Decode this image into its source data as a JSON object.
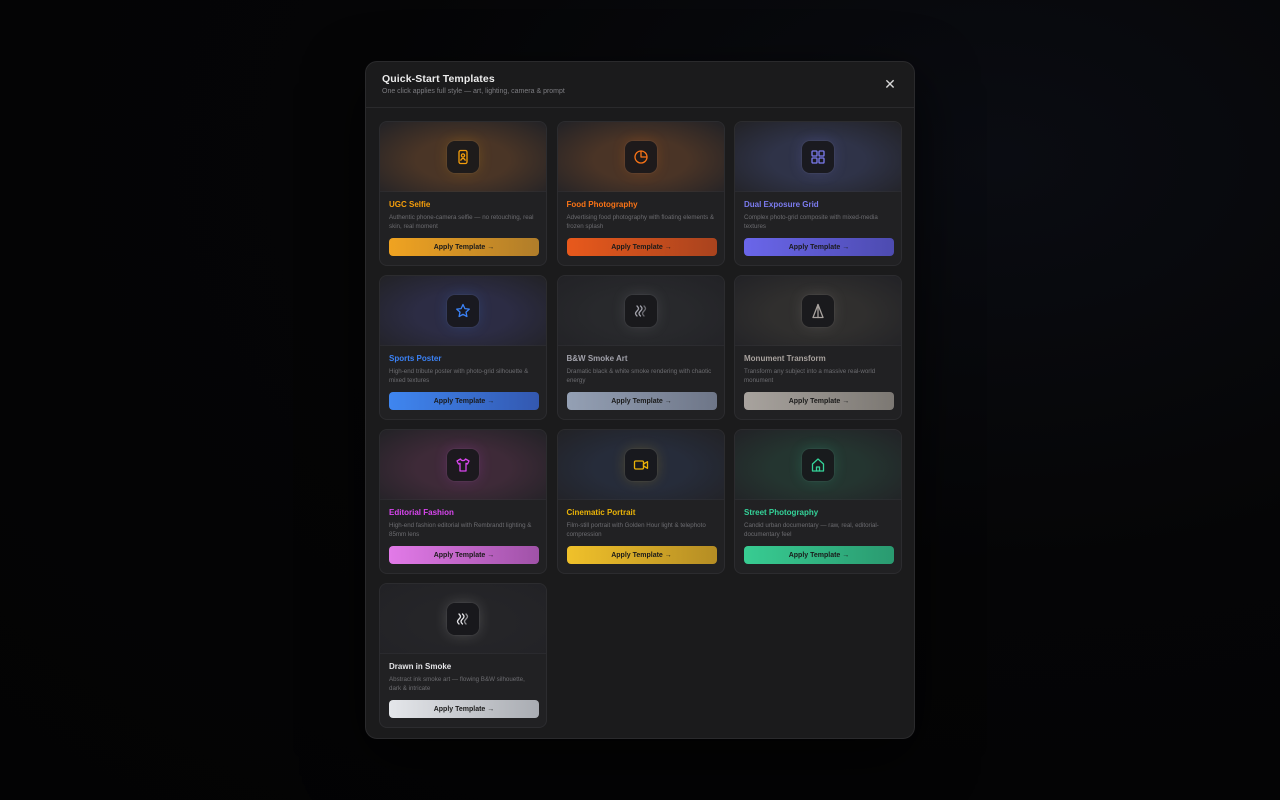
{
  "modal": {
    "title": "Quick-Start Templates",
    "subtitle": "One click applies full style — art, lighting, camera & prompt",
    "close_label": "✕"
  },
  "templates": [
    {
      "title": "UGC Selfie",
      "description": "Authentic phone-camera selfie — no retouching, real skin, real moment",
      "button_label": "Apply Template →",
      "icon": "phone-portrait-icon",
      "accent": "#f59e0b",
      "hero": "#4a3526",
      "button_from": "#f0a321",
      "button_to": "#b07d2a"
    },
    {
      "title": "Food Photography",
      "description": "Advertising food photography with floating elements & frozen splash",
      "button_label": "Apply Template →",
      "icon": "pie-chart-icon",
      "accent": "#f97316",
      "hero": "#4a3426",
      "button_from": "#e8591c",
      "button_to": "#a9431e"
    },
    {
      "title": "Dual Exposure Grid",
      "description": "Complex photo-grid composite with mixed-media textures",
      "button_label": "Apply Template →",
      "icon": "grid-icon",
      "accent": "#7c7cf0",
      "hero": "#2f3348",
      "button_from": "#6a66ea",
      "button_to": "#4d4bb0"
    },
    {
      "title": "Sports Poster",
      "description": "High-end tribute poster with photo-grid silhouette & mixed textures",
      "button_label": "Apply Template →",
      "icon": "star-icon",
      "accent": "#3b82f6",
      "hero": "#2c2c44",
      "button_from": "#3f86f0",
      "button_to": "#3358b0"
    },
    {
      "title": "B&W Smoke Art",
      "description": "Dramatic black & white smoke rendering with chaotic energy",
      "button_label": "Apply Template →",
      "icon": "smoke-wave-icon",
      "accent": "#a1a1aa",
      "hero": "#28292c",
      "button_from": "#94a0b4",
      "button_to": "#6e7688"
    },
    {
      "title": "Monument Transform",
      "description": "Transform any subject into a massive real-world monument",
      "button_label": "Apply Template →",
      "icon": "monument-icon",
      "accent": "#a8a29e",
      "hero": "#302f2e",
      "button_from": "#a8a39e",
      "button_to": "#7c7873"
    },
    {
      "title": "Editorial Fashion",
      "description": "High-end fashion editorial with Rembrandt lighting & 85mm lens",
      "button_label": "Apply Template →",
      "icon": "shirt-icon",
      "accent": "#d946ef",
      "hero": "#3e2a38",
      "button_from": "#e27ae8",
      "button_to": "#a052a8"
    },
    {
      "title": "Cinematic Portrait",
      "description": "Film-still portrait with Golden Hour light & telephoto compression",
      "button_label": "Apply Template →",
      "icon": "video-camera-icon",
      "accent": "#eab308",
      "hero": "#262c3a",
      "button_from": "#f0c12a",
      "button_to": "#b58d24"
    },
    {
      "title": "Street Photography",
      "description": "Candid urban documentary — raw, real, editorial-documentary feel",
      "button_label": "Apply Template →",
      "icon": "home-icon",
      "accent": "#34d399",
      "hero": "#243530",
      "button_from": "#38cc92",
      "button_to": "#2a9a70"
    },
    {
      "title": "Drawn in Smoke",
      "description": "Abstract ink smoke art — flowing B&W silhouette, dark & intricate",
      "button_label": "Apply Template →",
      "icon": "smoke-wave-icon",
      "accent": "#e4e4e7",
      "hero": "#252528",
      "button_from": "#e4e6ea",
      "button_to": "#a9acb2"
    }
  ]
}
